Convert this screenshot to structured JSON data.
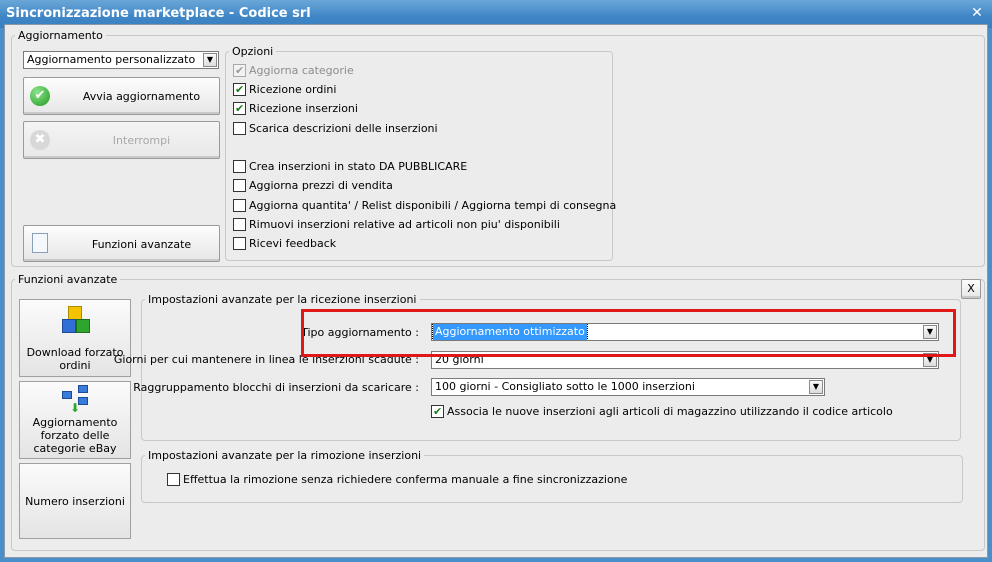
{
  "window": {
    "title": "Sincronizzazione marketplace - Codice srl",
    "close_glyph": "✕"
  },
  "aggiornamento": {
    "legend": "Aggiornamento",
    "mode_value": "Aggiornamento personalizzato",
    "start_label": "Avvia aggiornamento",
    "stop_label": "Interrompi",
    "advanced_label": "Funzioni avanzate"
  },
  "opzioni": {
    "legend": "Opzioni",
    "items": [
      {
        "label": "Aggiorna categorie",
        "checked": true,
        "disabled": true
      },
      {
        "label": "Ricezione ordini",
        "checked": true
      },
      {
        "label": "Ricezione inserzioni",
        "checked": true
      },
      {
        "label": "Scarica descrizioni delle inserzioni",
        "checked": false
      },
      {
        "label": "Crea inserzioni in stato DA PUBBLICARE",
        "checked": false
      },
      {
        "label": "Aggiorna prezzi di vendita",
        "checked": false
      },
      {
        "label": "Aggiorna quantita' / Relist disponibili / Aggiorna tempi di consegna",
        "checked": false
      },
      {
        "label": "Rimuovi inserzioni relative ad articoli non piu' disponibili",
        "checked": false
      },
      {
        "label": "Ricevi feedback",
        "checked": false
      }
    ]
  },
  "funzioni": {
    "legend": "Funzioni avanzate",
    "close_label": "X",
    "side_buttons": [
      {
        "lines": [
          "Download forzato",
          "ordini"
        ]
      },
      {
        "lines": [
          "Aggiornamento",
          "forzato delle",
          "categorie eBay"
        ]
      },
      {
        "lines": [
          "Numero inserzioni"
        ]
      }
    ],
    "ricezione": {
      "legend": "Impostazioni avanzate per la ricezione inserzioni",
      "tipo_label": "Tipo aggiornamento :",
      "tipo_value": "Aggiornamento ottimizzato",
      "giorni_label": "Giorni per cui mantenere in linea le inserzioni scadute :",
      "giorni_value": "20 giorni",
      "raggr_label": "Raggruppamento blocchi di inserzioni da scaricare :",
      "raggr_value": "100 giorni - Consigliato sotto le 1000 inserzioni",
      "associa_label": "Associa le nuove inserzioni agli articoli di magazzino utilizzando il codice articolo",
      "associa_checked": true
    },
    "rimozione": {
      "legend": "Impostazioni avanzate per la rimozione inserzioni",
      "effettua_label": "Effettua la rimozione senza richiedere conferma manuale a fine sincronizzazione",
      "effettua_checked": false
    }
  },
  "colors": {
    "highlight": "#e01818",
    "selection": "#3399ff",
    "titlebar": "#3f86c6"
  }
}
